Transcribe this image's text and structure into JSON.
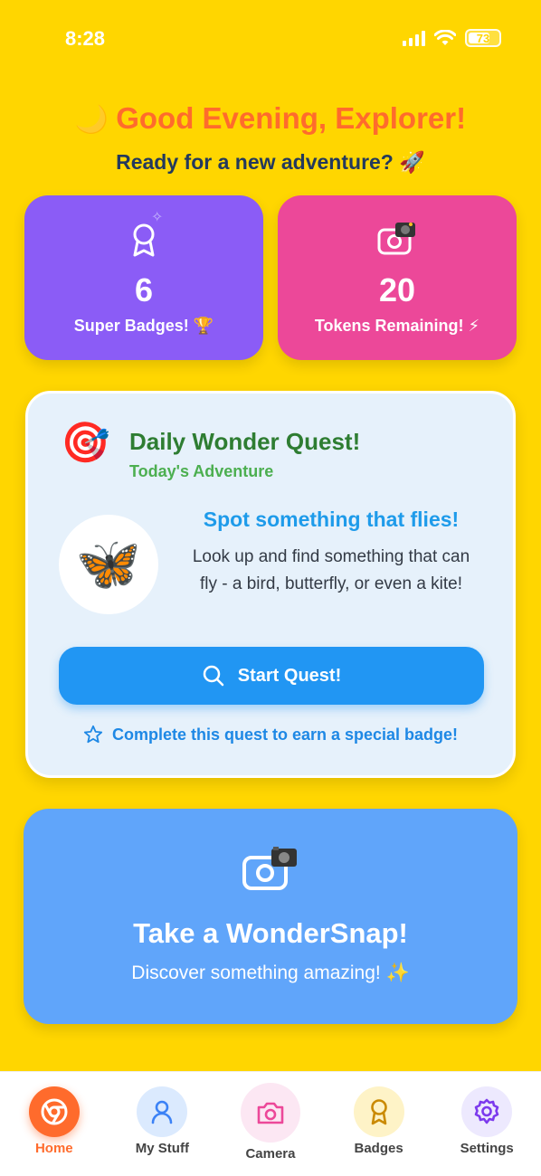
{
  "status_bar": {
    "time": "8:28",
    "battery": "73",
    "battery_level": 0.73
  },
  "greeting": {
    "icon": "🌙",
    "title": "Good Evening, Explorer!",
    "subtitle": "Ready for a new adventure? 🚀"
  },
  "stats": {
    "badges": {
      "value": "6",
      "label": "Super Badges! 🏆",
      "icon": "award-icon",
      "color": "#8B5CF6"
    },
    "tokens": {
      "value": "20",
      "label": "Tokens Remaining! ⚡",
      "icon": "camera-icon",
      "color": "#EC4899"
    }
  },
  "quest": {
    "icon": "🎯",
    "title": "Daily Wonder Quest!",
    "subtitle": "Today's Adventure",
    "image": "🦋",
    "headline": "Spot something that flies!",
    "description": "Look up and find something that can fly - a bird, butterfly, or even a kite!",
    "button_label": "Start Quest!",
    "reward": "Complete this quest to earn a special badge!"
  },
  "snap": {
    "title": "Take a WonderSnap!",
    "subtitle": "Discover something amazing! ✨",
    "color": "#60A5FA"
  },
  "tabs": [
    {
      "label": "Home",
      "icon": "home-icon"
    },
    {
      "label": "My Stuff",
      "icon": "user-icon"
    },
    {
      "label": "Camera",
      "icon": "camera-icon"
    },
    {
      "label": "Badges",
      "icon": "award-icon"
    },
    {
      "label": "Settings",
      "icon": "gear-icon"
    }
  ],
  "colors": {
    "background": "#FFD600",
    "accent": "#FF6B2C",
    "primary_button": "#2196F3"
  }
}
